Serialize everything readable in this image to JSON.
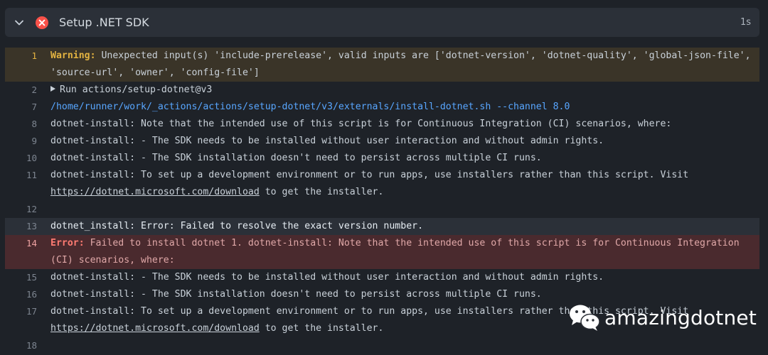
{
  "step": {
    "title": "Setup .NET SDK",
    "duration": "1s",
    "status": "failed",
    "status_icon": "x-circle-icon",
    "status_color": "#f85149"
  },
  "log": {
    "l1": {
      "no": "1",
      "label": "Warning:",
      "text": " Unexpected input(s) 'include-prerelease', valid inputs are ['dotnet-version', 'dotnet-quality', 'global-json-file', 'source-url', 'owner', 'config-file']"
    },
    "l2": {
      "no": "2",
      "text": "Run actions/setup-dotnet@v3"
    },
    "l7": {
      "no": "7",
      "text": "/home/runner/work/_actions/actions/setup-dotnet/v3/externals/install-dotnet.sh --channel 8.0"
    },
    "l8": {
      "no": "8",
      "text": "dotnet-install: Note that the intended use of this script is for Continuous Integration (CI) scenarios, where:"
    },
    "l9": {
      "no": "9",
      "text": "dotnet-install: - The SDK needs to be installed without user interaction and without admin rights."
    },
    "l10": {
      "no": "10",
      "text": "dotnet-install: - The SDK installation doesn't need to persist across multiple CI runs."
    },
    "l11": {
      "no": "11",
      "text": "dotnet-install: To set up a development environment or to run apps, use installers rather than this script. Visit ",
      "link": "https://dotnet.microsoft.com/download",
      "after": " to get the installer."
    },
    "l12": {
      "no": "12",
      "text": ""
    },
    "l13": {
      "no": "13",
      "text": "dotnet_install: Error: Failed to resolve the exact version number."
    },
    "l14": {
      "no": "14",
      "label": "Error:",
      "text": " Failed to install dotnet 1. dotnet-install: Note that the intended use of this script is for Continuous Integration (CI) scenarios, where:"
    },
    "l15": {
      "no": "15",
      "text": "dotnet-install: - The SDK needs to be installed without user interaction and without admin rights."
    },
    "l16": {
      "no": "16",
      "text": "dotnet-install: - The SDK installation doesn't need to persist across multiple CI runs."
    },
    "l17": {
      "no": "17",
      "text": "dotnet-install: To set up a development environment or to run apps, use installers rather than this script. Visit ",
      "link": "https://dotnet.microsoft.com/download",
      "after": " to get the installer."
    },
    "l18": {
      "no": "18",
      "text": ""
    }
  },
  "watermark": {
    "text": "amazingdotnet",
    "icon": "wechat-icon"
  },
  "colors": {
    "background": "#1e2228",
    "warning": "#e3b341",
    "error": "#ff7b72",
    "command": "#58a6ff"
  }
}
